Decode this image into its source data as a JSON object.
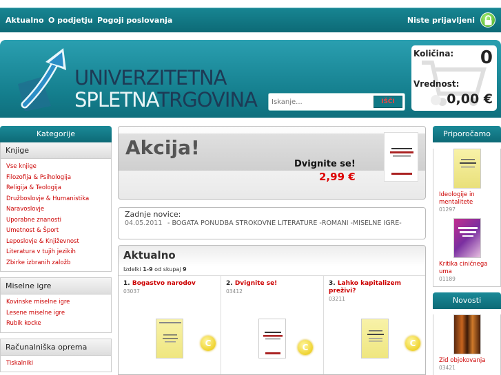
{
  "nav": {
    "items": [
      "Aktualno",
      "O podjetju",
      "Pogoji poslovanja"
    ],
    "login_status": "Niste prijavljeni"
  },
  "logo": {
    "line1": "UNIVERZITETNA",
    "line2_light": "SPLETNA",
    "line2_dark": "TRGOVINA"
  },
  "search": {
    "placeholder": "Iskanje...",
    "button": "IŠČI"
  },
  "cart": {
    "qty_label": "Količina:",
    "qty_value": "0",
    "value_label": "Vrednost:",
    "value_amount": "0,00 €"
  },
  "sidebar": {
    "heading": "Kategorije",
    "groups": [
      {
        "title": "Knjige",
        "items": [
          "Vse knjige",
          "Filozofija & Psihologija",
          "Religija & Teologija",
          "Družboslovje & Humanistika",
          "Naravoslovje",
          "Uporabne znanosti",
          "Umetnost & Šport",
          "Leposlovje & Književnost",
          "Literatura v tujih jezikih",
          "Zbirke izbranih založb"
        ]
      },
      {
        "title": "Miselne igre",
        "items": [
          "Kovinske miselne igre",
          "Lesene miselne igre",
          "Rubik kocke"
        ]
      },
      {
        "title": "Računalniška oprema",
        "items": [
          "Tiskalniki",
          ""
        ]
      }
    ]
  },
  "promo": {
    "title": "Akcija!",
    "book_title": "Dvignite se!",
    "price": "2,99 €"
  },
  "news": {
    "title": "Zadnje novice:",
    "date": "04.05.2011",
    "text": "- BOGATA PONUDBA STROKOVNE LITERATURE -ROMANI -MISELNE IGRE-"
  },
  "products": {
    "title": "Aktualno",
    "count_prefix": "Izdelki ",
    "count_range": "1-9",
    "count_mid": " od skupaj ",
    "count_total": "9",
    "items": [
      {
        "num": "1.",
        "name": "Bogastvo narodov",
        "code": "03037"
      },
      {
        "num": "2.",
        "name": "Dvignite se!",
        "code": "03412"
      },
      {
        "num": "3.",
        "name": "Lahko kapitalizem preživi?",
        "code": "03211"
      }
    ],
    "badge": "C"
  },
  "right": {
    "recommend_heading": "Priporočamo",
    "recommend": [
      {
        "name": "Ideologije in mentalitete",
        "code": "01297"
      },
      {
        "name": "Kritika ciničnega uma",
        "code": "01189"
      }
    ],
    "news_heading": "Novosti",
    "news": [
      {
        "name": "Zid objokovanja",
        "code": "03421"
      }
    ]
  },
  "colors": {
    "teal": "#147e8d",
    "link_red": "#cc0000",
    "price_red": "#dd0000"
  }
}
